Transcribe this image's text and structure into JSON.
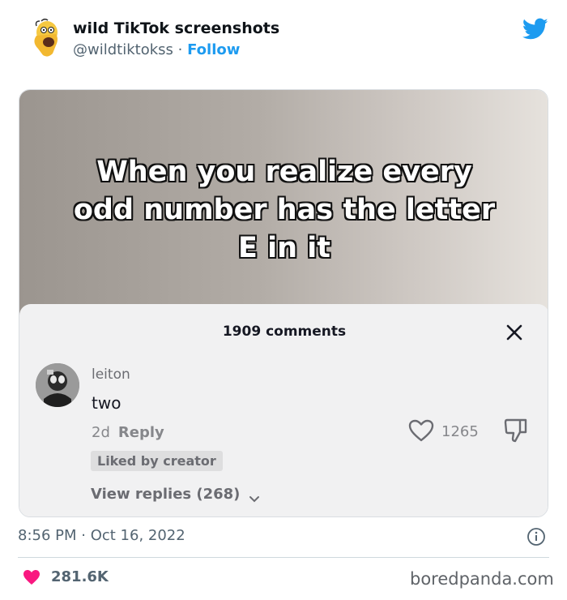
{
  "tweet": {
    "author_name": "wild TikTok screenshots",
    "author_handle": "@wildtiktokss",
    "separator": "·",
    "follow_label": "Follow",
    "timestamp": "8:56 PM · Oct 16, 2022",
    "likes": "281.6K"
  },
  "video": {
    "caption_line1": "When you realize every",
    "caption_line2": "odd number has the letter",
    "caption_line3": "E in it"
  },
  "comments": {
    "count_label": "1909 comments",
    "username": "leiton",
    "text": "two",
    "age": "2d",
    "reply_label": "Reply",
    "badge": "Liked by creator",
    "view_replies": "View replies (268)",
    "like_count": "1265"
  },
  "watermark": "boredpanda.com",
  "colors": {
    "accent": "#1d9bf0",
    "heart": "#f91880",
    "text_secondary": "#536471"
  },
  "icons": [
    "twitter-bird-icon",
    "close-icon",
    "heart-outline-icon",
    "dislike-icon",
    "chevron-down-icon",
    "info-icon",
    "heart-icon"
  ]
}
